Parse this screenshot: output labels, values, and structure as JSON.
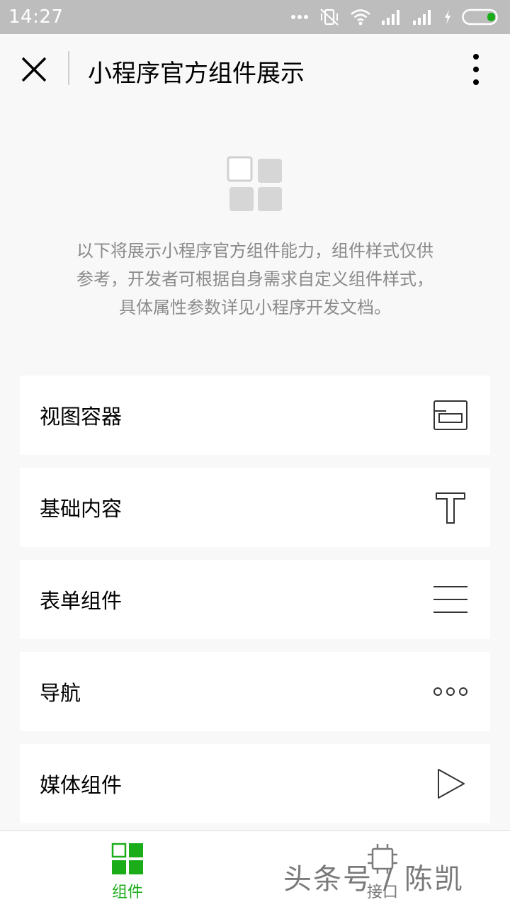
{
  "status_bar": {
    "time": "14:27",
    "battery_color": "#1aad19"
  },
  "header": {
    "title": "小程序官方组件展示",
    "close_icon": "close-icon",
    "more_icon": "more-vertical-icon"
  },
  "intro": {
    "logo_icon": "component-grid-icon",
    "lines": [
      "以下将展示小程序官方组件能力，组件样式仅供",
      "参考，开发者可根据自身需求自定义组件样式，",
      "具体属性参数详见小程序开发文档。"
    ]
  },
  "list": {
    "items": [
      {
        "label": "视图容器",
        "icon": "view-container-icon"
      },
      {
        "label": "基础内容",
        "icon": "text-t-icon"
      },
      {
        "label": "表单组件",
        "icon": "form-lines-icon"
      },
      {
        "label": "导航",
        "icon": "dots-icon"
      },
      {
        "label": "媒体组件",
        "icon": "play-icon"
      }
    ]
  },
  "tabbar": {
    "active_color": "#1aad19",
    "tabs": [
      {
        "label": "组件",
        "icon": "components-tab-icon",
        "active": true
      },
      {
        "label": "接口",
        "icon": "api-tab-icon",
        "active": false
      }
    ]
  },
  "watermark": {
    "text": "头条号 / 陈凯"
  }
}
